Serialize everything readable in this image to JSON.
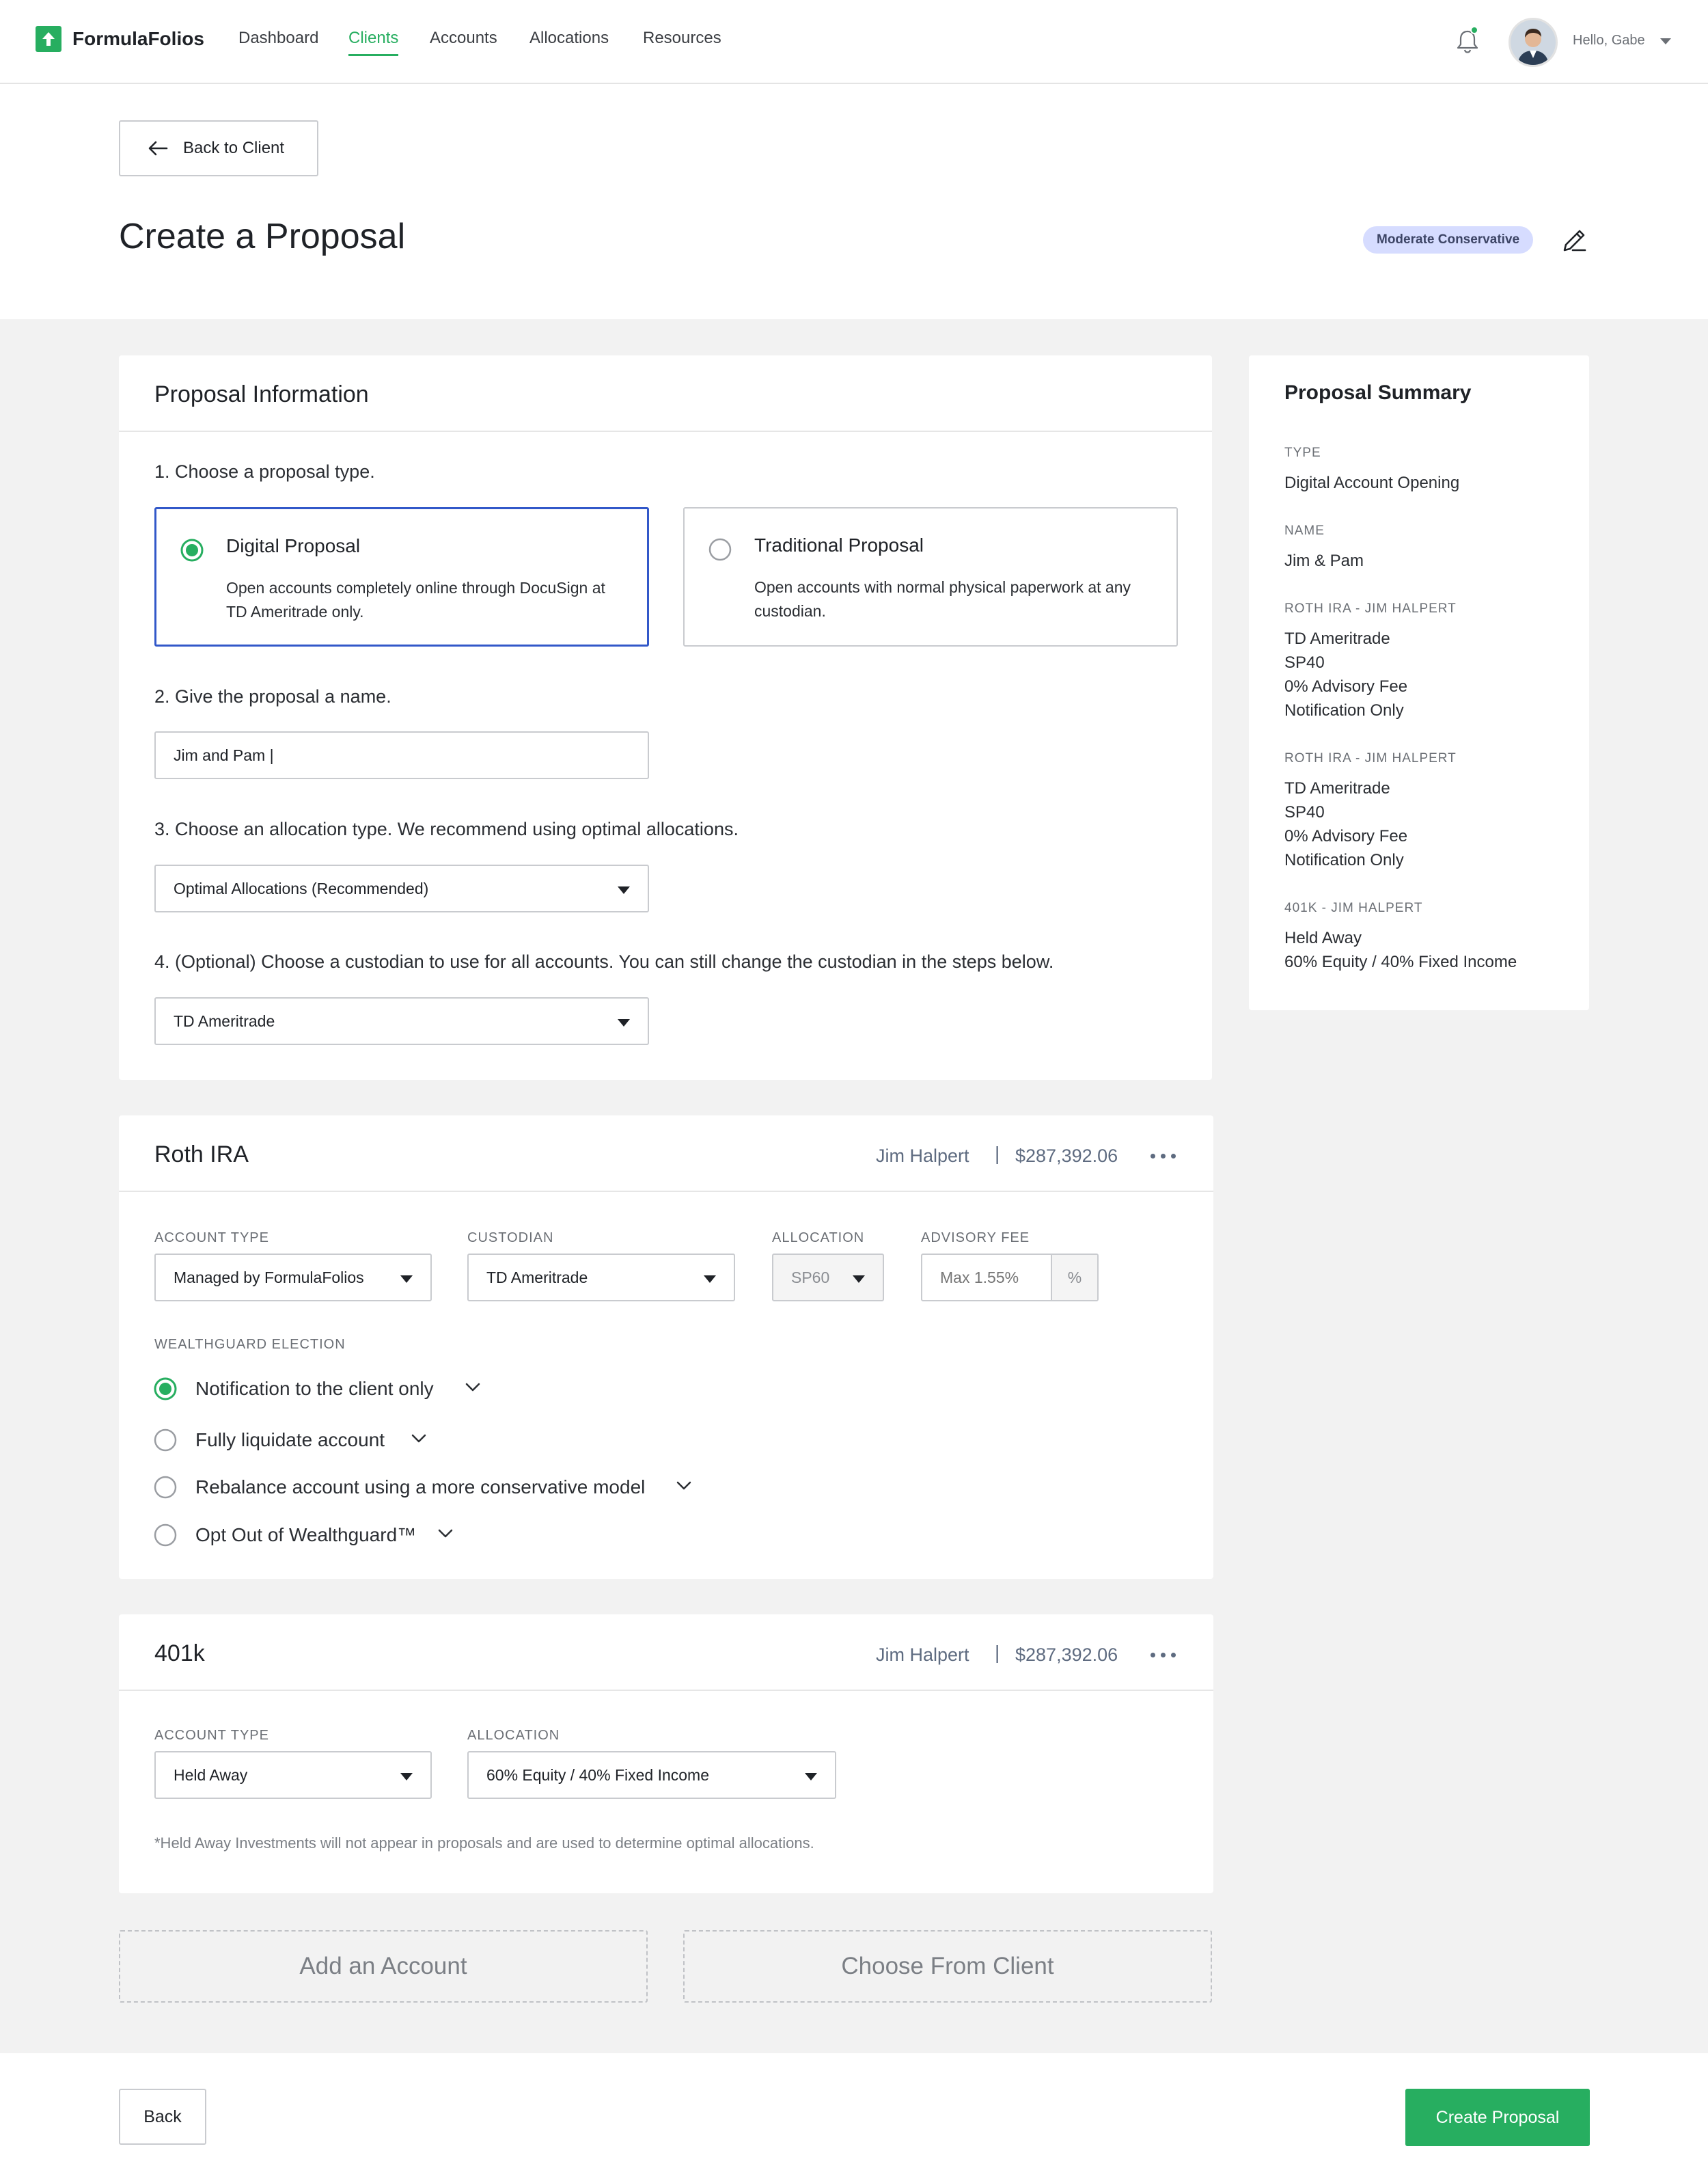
{
  "nav": {
    "brand": "FormulaFolios",
    "items": [
      "Dashboard",
      "Clients",
      "Accounts",
      "Allocations",
      "Resources"
    ],
    "active": "Clients",
    "greeting": "Hello, Gabe"
  },
  "header": {
    "back_to_client": "Back to Client",
    "title": "Create a Proposal",
    "risk_badge": "Moderate Conservative"
  },
  "proposal_info": {
    "title": "Proposal Information",
    "step1": "1. Choose a proposal type.",
    "types": [
      {
        "title": "Digital Proposal",
        "desc": "Open accounts completely online through DocuSign at TD Ameritrade only.",
        "selected": true
      },
      {
        "title": "Traditional Proposal",
        "desc": "Open accounts with normal physical paperwork at any custodian.",
        "selected": false
      }
    ],
    "step2": "2. Give the proposal a name.",
    "name_value": "Jim and Pam |",
    "step3": "3. Choose an allocation type. We recommend using optimal allocations.",
    "allocation_type": "Optimal Allocations (Recommended)",
    "step4": "4. (Optional) Choose a custodian to use for all accounts. You can still change the custodian in the steps below.",
    "custodian": "TD Ameritrade"
  },
  "roth": {
    "title": "Roth IRA",
    "owner": "Jim Halpert",
    "separator": "|",
    "amount": "$287,392.06",
    "account_type_label": "ACCOUNT TYPE",
    "account_type": "Managed by FormulaFolios",
    "custodian_label": "CUSTODIAN",
    "custodian": "TD Ameritrade",
    "allocation_label": "ALLOCATION",
    "allocation": "SP60",
    "fee_label": "ADVISORY FEE",
    "fee_placeholder": "Max 1.55%",
    "fee_unit": "%",
    "wealthguard_label": "WEALTHGUARD ELECTION",
    "wealthguard_options": [
      {
        "label": "Notification to the client only",
        "selected": true
      },
      {
        "label": "Fully liquidate account",
        "selected": false
      },
      {
        "label": "Rebalance account using a more conservative model",
        "selected": false
      },
      {
        "label": "Opt Out of Wealthguard™",
        "selected": false
      }
    ]
  },
  "k401": {
    "title": "401k",
    "owner": "Jim Halpert",
    "separator": "|",
    "amount": "$287,392.06",
    "account_type_label": "ACCOUNT TYPE",
    "account_type": "Held Away",
    "allocation_label": "ALLOCATION",
    "allocation": "60% Equity / 40% Fixed Income",
    "note": "*Held Away Investments will not appear in proposals and are used to determine optimal allocations."
  },
  "actions": {
    "add_account": "Add an Account",
    "choose_from_client": "Choose From Client",
    "back": "Back",
    "create": "Create Proposal"
  },
  "summary": {
    "title": "Proposal Summary",
    "type_label": "TYPE",
    "type_value": "Digital Account Opening",
    "name_label": "NAME",
    "name_value": "Jim & Pam",
    "accounts": [
      {
        "label": "ROTH IRA - JIM HALPERT",
        "lines": [
          "TD Ameritrade",
          "SP40",
          "0% Advisory Fee",
          "Notification Only"
        ]
      },
      {
        "label": "ROTH IRA - JIM HALPERT",
        "lines": [
          "TD Ameritrade",
          "SP40",
          "0% Advisory Fee",
          "Notification Only"
        ]
      },
      {
        "label": "401K - JIM HALPERT",
        "lines": [
          "Held Away",
          "60% Equity / 40% Fixed Income"
        ]
      }
    ]
  },
  "colors": {
    "brand_green": "#27ae60",
    "selected_border": "#3258c9",
    "badge_bg": "#d6dcff",
    "page_gray": "#f2f2f2"
  },
  "icons": [
    "logo-icon",
    "bell-icon",
    "avatar",
    "arrow-left-icon",
    "pencil-icon",
    "caret-down-icon",
    "chevron-down-icon",
    "more-icon"
  ]
}
